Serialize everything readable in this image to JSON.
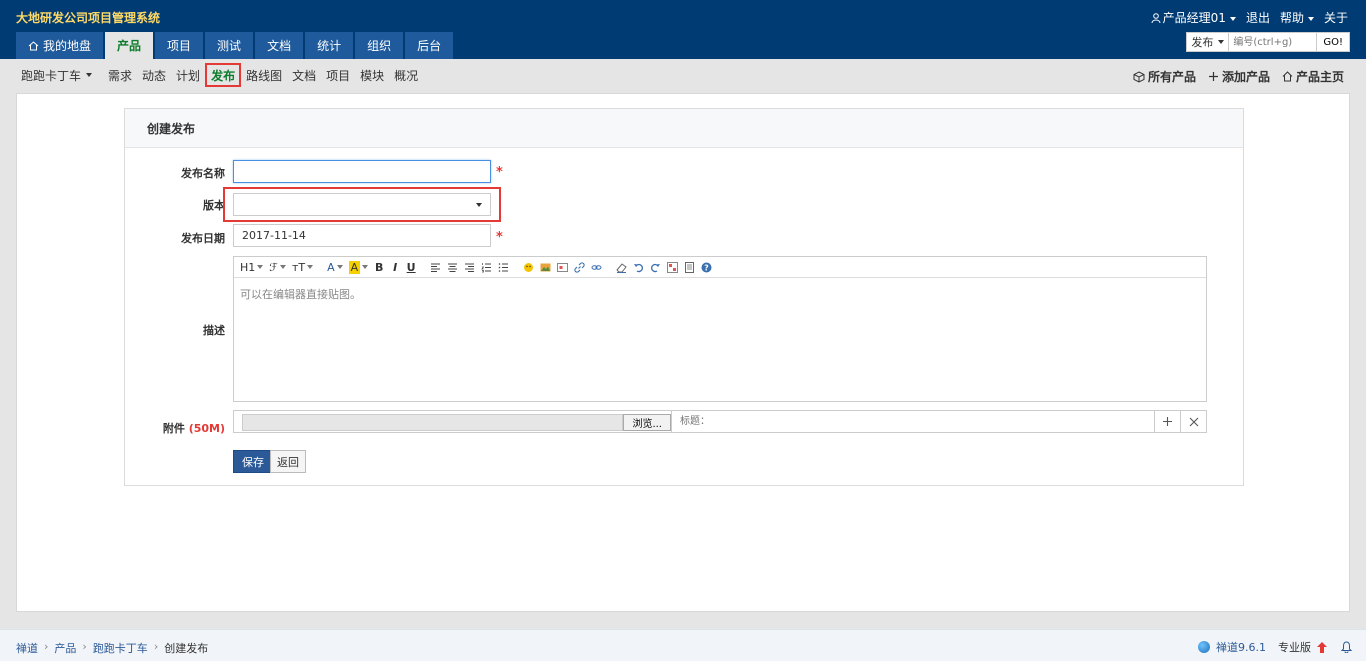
{
  "header": {
    "app_title": "大地研发公司项目管理系统",
    "user": "产品经理01",
    "logout": "退出",
    "help": "帮助",
    "about": "关于",
    "search": {
      "type": "发布",
      "placeholder": "编号(ctrl+g)",
      "go": "GO!"
    }
  },
  "main_nav": [
    {
      "label": "我的地盘",
      "icon": "home-icon"
    },
    {
      "label": "产品",
      "active": true
    },
    {
      "label": "项目"
    },
    {
      "label": "测试"
    },
    {
      "label": "文档"
    },
    {
      "label": "统计"
    },
    {
      "label": "组织"
    },
    {
      "label": "后台"
    }
  ],
  "sub_nav": {
    "product_selector": "跑跑卡丁车",
    "items": [
      "需求",
      "动态",
      "计划",
      "发布",
      "路线图",
      "文档",
      "项目",
      "模块",
      "概况"
    ],
    "active": "发布",
    "right": {
      "all_products": "所有产品",
      "add_product": "添加产品",
      "product_home": "产品主页"
    }
  },
  "form": {
    "title": "创建发布",
    "name_label": "发布名称",
    "version_label": "版本",
    "date_label": "发布日期",
    "date_value": "2017-11-14",
    "desc_label": "描述",
    "editor_placeholder": "可以在编辑器直接贴图。",
    "attach_label": "附件",
    "attach_limit": "(50M)",
    "browse": "浏览...",
    "title_placeholder": "标题：",
    "save": "保存",
    "back": "返回",
    "required_mark": "*"
  },
  "editor_toolbar": {
    "heading": "H1",
    "font": "ℱ",
    "size": "тT",
    "color": "A",
    "bg": "A",
    "bold": "B",
    "italic": "I",
    "underline": "U"
  },
  "footer": {
    "breadcrumb": [
      "禅道",
      "产品",
      "跑跑卡丁车",
      "创建发布"
    ],
    "version": "禅道9.6.1",
    "edition": "专业版"
  },
  "colors": {
    "header_bg": "#003b73",
    "tab_bg": "#1e5a9c",
    "active_green": "#0e7d2b",
    "highlight_red": "#e53935",
    "save_blue": "#2c5a99"
  }
}
